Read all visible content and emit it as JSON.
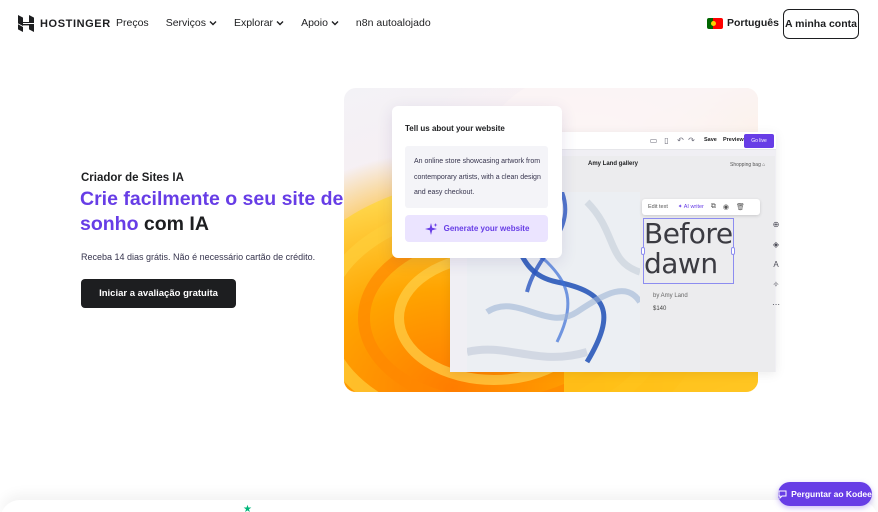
{
  "nav": {
    "brand": "HOSTINGER",
    "items": [
      {
        "label": "Preços",
        "dropdown": false
      },
      {
        "label": "Serviços",
        "dropdown": true
      },
      {
        "label": "Explorar",
        "dropdown": true
      },
      {
        "label": "Apoio",
        "dropdown": true
      },
      {
        "label": "n8n autoalojado",
        "dropdown": false
      }
    ],
    "language": "Português",
    "account_button": "A minha conta"
  },
  "hero": {
    "eyebrow": "Criador de Sites IA",
    "title_purple": "Crie facilmente o seu site de sonho",
    "title_dark": " com IA",
    "subtitle": "Receba 14 dias grátis. Não é necessário cartão de crédito.",
    "cta": "Iniciar a avaliação gratuita"
  },
  "prompt_card": {
    "title": "Tell us about your website",
    "prompt_text": "An online store showcasing artwork from contemporary artists, with a clean design and easy checkout.",
    "button": "Generate your website"
  },
  "editor": {
    "save": "Save",
    "preview": "Preview",
    "go_live": "Go live",
    "site_brand": "Amy Land gallery",
    "shopping_bag": "Shopping bag",
    "toolbar_edit": "Edit text",
    "toolbar_ai": "AI writer",
    "artwork_title_line1": "Before",
    "artwork_title_line2": "dawn",
    "artist": "by Amy Land",
    "price": "$140"
  },
  "chat_button": "Perguntar ao Kodee",
  "colors": {
    "accent": "#673de6",
    "dark": "#1d1e20",
    "accent_light": "#ebe4ff"
  }
}
